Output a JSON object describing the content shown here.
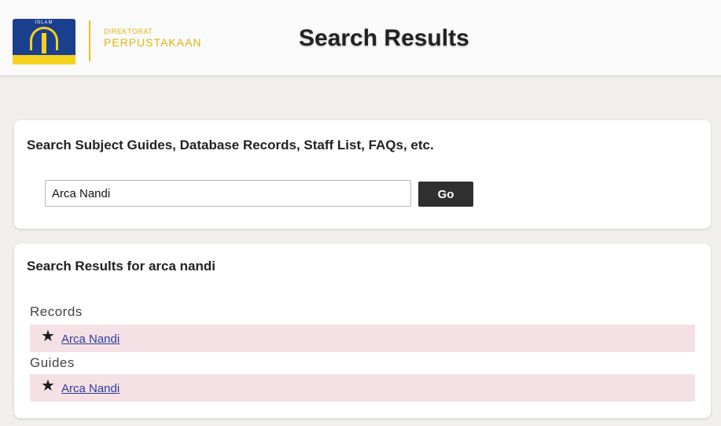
{
  "header": {
    "logo_text": "ISLAM",
    "brand_line1": "DIREKTORAT",
    "brand_line2": "PERPUSTAKAAN",
    "page_title": "Search Results"
  },
  "search": {
    "heading": "Search Subject Guides, Database Records, Staff List, FAQs, etc.",
    "query_value": "Arca Nandi",
    "go_label": "Go"
  },
  "results": {
    "heading": "Search Results for arca nandi",
    "sections": [
      {
        "label": "Records",
        "items": [
          {
            "title": "Arca Nandi",
            "icon": "star-icon"
          }
        ]
      },
      {
        "label": "Guides",
        "items": [
          {
            "title": "Arca Nandi",
            "icon": "star-icon"
          }
        ]
      }
    ]
  },
  "colors": {
    "result_row_bg": "#f5e1e5",
    "link": "#2a3d9a",
    "brand_gold": "#e2b312",
    "button_bg": "#2f2f2f"
  }
}
